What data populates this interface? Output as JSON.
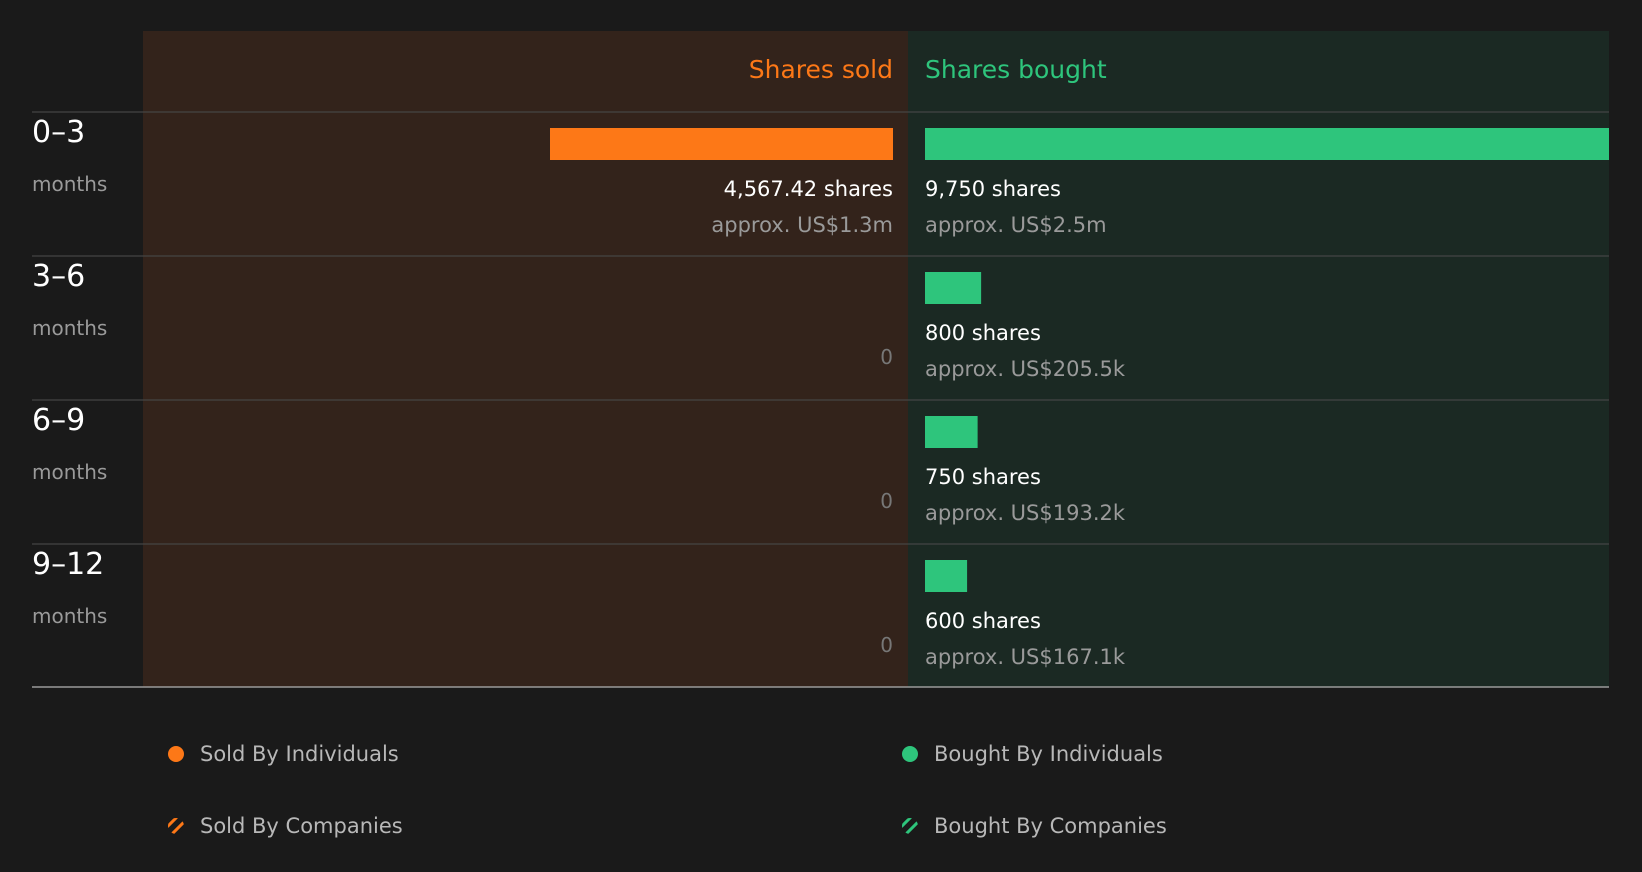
{
  "chart_data": {
    "type": "bar",
    "headers": {
      "sold": "Shares sold",
      "bought": "Shares bought"
    },
    "unit_label": "months",
    "rows": [
      {
        "period": "0–3",
        "sold_shares": 4567.42,
        "sold_label": "4,567.42 shares",
        "sold_value": "approx. US$1.3m",
        "bought_shares": 9750,
        "bought_label": "9,750 shares",
        "bought_value": "approx. US$2.5m"
      },
      {
        "period": "3–6",
        "sold_shares": 0,
        "sold_label": "0",
        "sold_value": "",
        "bought_shares": 800,
        "bought_label": "800 shares",
        "bought_value": "approx. US$205.5k"
      },
      {
        "period": "6–9",
        "sold_shares": 0,
        "sold_label": "0",
        "sold_value": "",
        "bought_shares": 750,
        "bought_label": "750 shares",
        "bought_value": "approx. US$193.2k"
      },
      {
        "period": "9–12",
        "sold_shares": 0,
        "sold_label": "0",
        "sold_value": "",
        "bought_shares": 600,
        "bought_label": "600 shares",
        "bought_value": "approx. US$167.1k"
      }
    ],
    "max_shares": 9750,
    "colors": {
      "sold": "#fd7817",
      "bought": "#2ec57c",
      "sold_bg": "#33231b",
      "bought_bg": "#1b2923",
      "label": "#ffffff",
      "muted": "#9a9a9a",
      "zero": "#777777"
    }
  },
  "legend": {
    "sold_individuals": "Sold By Individuals",
    "sold_companies": "Sold By Companies",
    "bought_individuals": "Bought By Individuals",
    "bought_companies": "Bought By Companies"
  }
}
